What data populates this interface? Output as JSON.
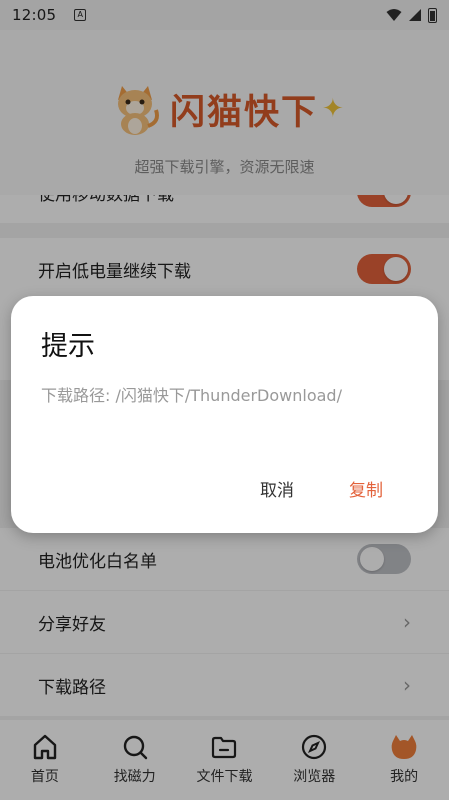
{
  "status_bar": {
    "time": "12:05",
    "notif_icon": "A"
  },
  "header": {
    "brand": "闪猫快下",
    "subtitle": "超强下载引擎，资源无限速"
  },
  "settings": [
    {
      "label": "使用移动数据下载",
      "control": "toggle",
      "on": true
    },
    {
      "label": "开启低电量继续下载",
      "control": "toggle",
      "on": true
    },
    {
      "label": "电池优化白名单",
      "control": "toggle",
      "on": false
    },
    {
      "label": "分享好友",
      "control": "chevron"
    },
    {
      "label": "下载路径",
      "control": "chevron"
    }
  ],
  "bottom_nav": [
    {
      "label": "首页",
      "icon": "home-icon"
    },
    {
      "label": "找磁力",
      "icon": "search-icon"
    },
    {
      "label": "文件下载",
      "icon": "folder-icon"
    },
    {
      "label": "浏览器",
      "icon": "compass-icon"
    },
    {
      "label": "我的",
      "icon": "cat-icon",
      "active": true
    }
  ],
  "dialog": {
    "title": "提示",
    "message": "下载路径: /闪猫快下/ThunderDownload/",
    "cancel_label": "取消",
    "confirm_label": "复制"
  },
  "colors": {
    "accent": "#e3623b",
    "brand": "#d85a2a"
  }
}
